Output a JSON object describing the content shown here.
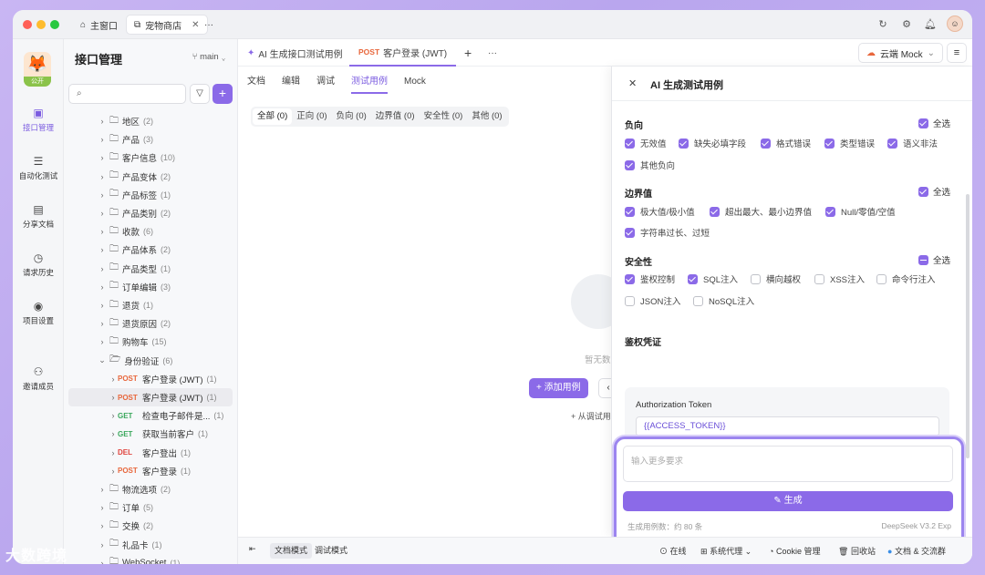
{
  "titlebar": {
    "tabs": [
      {
        "label": "主窗口",
        "icon": "home-icon"
      },
      {
        "label": "宠物商店",
        "icon": "pet-store-icon",
        "close": "✕"
      }
    ],
    "more": "···"
  },
  "rail": {
    "project_badge": "公开",
    "items": [
      {
        "label": "接口管理",
        "icon": "api-icon"
      },
      {
        "label": "自动化测试",
        "icon": "automation-icon"
      },
      {
        "label": "分享文档",
        "icon": "share-docs-icon"
      },
      {
        "label": "请求历史",
        "icon": "history-icon"
      },
      {
        "label": "项目设置",
        "icon": "settings-icon"
      },
      {
        "label": "邀请成员",
        "icon": "invite-icon"
      }
    ]
  },
  "tree": {
    "title": "接口管理",
    "branch": "main",
    "nodes": [
      {
        "type": "folder",
        "label": "地区",
        "count": "(2)"
      },
      {
        "type": "folder",
        "label": "产品",
        "count": "(3)"
      },
      {
        "type": "folder",
        "label": "客户信息",
        "count": "(10)"
      },
      {
        "type": "folder",
        "label": "产品变体",
        "count": "(2)"
      },
      {
        "type": "folder",
        "label": "产品标签",
        "count": "(1)"
      },
      {
        "type": "folder",
        "label": "产品类别",
        "count": "(2)"
      },
      {
        "type": "folder",
        "label": "收款",
        "count": "(6)"
      },
      {
        "type": "folder",
        "label": "产品体系",
        "count": "(2)"
      },
      {
        "type": "folder",
        "label": "产品类型",
        "count": "(1)"
      },
      {
        "type": "folder",
        "label": "订单编辑",
        "count": "(3)"
      },
      {
        "type": "folder",
        "label": "退货",
        "count": "(1)"
      },
      {
        "type": "folder",
        "label": "退货原因",
        "count": "(2)"
      },
      {
        "type": "folder",
        "label": "购物车",
        "count": "(15)"
      },
      {
        "type": "folder-open",
        "label": "身份验证",
        "count": "(6)"
      },
      {
        "type": "api",
        "method": "POST",
        "label": "客户登录 (JWT)",
        "count": "(1)"
      },
      {
        "type": "api",
        "method": "POST",
        "label": "客户登录 (JWT)",
        "count": "(1)",
        "selected": true
      },
      {
        "type": "api",
        "method": "GET",
        "label": "检查电子邮件是...",
        "count": "(1)"
      },
      {
        "type": "api",
        "method": "GET",
        "label": "获取当前客户",
        "count": "(1)"
      },
      {
        "type": "api",
        "method": "DEL",
        "label": "客户登出",
        "count": "(1)"
      },
      {
        "type": "api",
        "method": "POST",
        "label": "客户登录",
        "count": "(1)"
      },
      {
        "type": "folder",
        "label": "物流选项",
        "count": "(2)"
      },
      {
        "type": "folder",
        "label": "订单",
        "count": "(5)"
      },
      {
        "type": "folder",
        "label": "交换",
        "count": "(2)"
      },
      {
        "type": "folder",
        "label": "礼品卡",
        "count": "(1)"
      },
      {
        "type": "folder",
        "label": "WebSocket",
        "count": "(1)"
      }
    ]
  },
  "main": {
    "tabs": [
      {
        "label": "AI 生成接口测试用例",
        "icon": "sparkle-icon"
      },
      {
        "method": "POST",
        "label": "客户登录 (JWT)"
      }
    ],
    "mock_env": "云端 Mock",
    "subtabs": [
      "文档",
      "编辑",
      "调试",
      "测试用例",
      "Mock"
    ],
    "filters": [
      "全部 (0)",
      "正向 (0)",
      "负向 (0)",
      "边界值 (0)",
      "安全性 (0)",
      "其他 (0)"
    ],
    "empty_text": "暂无数",
    "add_case": "+ 添加用例",
    "from_text": "+ 从调试用"
  },
  "drawer": {
    "title": "AI 生成测试用例",
    "select_all": "全选",
    "sections": [
      {
        "title": "负向",
        "options": [
          {
            "label": "无效值",
            "checked": true
          },
          {
            "label": "缺失必填字段",
            "checked": true
          },
          {
            "label": "格式错误",
            "checked": true
          },
          {
            "label": "类型错误",
            "checked": true
          },
          {
            "label": "语义非法",
            "checked": true
          },
          {
            "label": "其他负向",
            "checked": true
          }
        ]
      },
      {
        "title": "边界值",
        "options": [
          {
            "label": "极大值/极小值",
            "checked": true
          },
          {
            "label": "超出最大、最小边界值",
            "checked": true
          },
          {
            "label": "Null/零值/空值",
            "checked": true
          },
          {
            "label": "字符串过长、过短",
            "checked": true
          }
        ]
      },
      {
        "title": "安全性",
        "options": [
          {
            "label": "鉴权控制",
            "checked": true
          },
          {
            "label": "SQL注入",
            "checked": true
          },
          {
            "label": "横向越权",
            "checked": false
          },
          {
            "label": "XSS注入",
            "checked": false
          },
          {
            "label": "命令行注入",
            "checked": false
          },
          {
            "label": "JSON注入",
            "checked": false
          },
          {
            "label": "NoSQL注入",
            "checked": false
          }
        ]
      }
    ],
    "auth_title": "鉴权凭证",
    "auth_label": "Authorization Token",
    "auth_value": "{{ACCESS_TOKEN}}",
    "chat_placeholder": "输入更多要求",
    "generate": "生成",
    "estimate": "生成用例数：约 80 条",
    "model": "DeepSeek V3.2 Exp"
  },
  "statusbar": {
    "modes": [
      "文档模式",
      "调试模式"
    ],
    "items": [
      "在线",
      "系统代理",
      "Cookie 管理",
      "回收站",
      "文档 & 交流群"
    ]
  },
  "watermark": "大数跨境",
  "colors": {
    "accent": "#8b6ae8",
    "post": "#e8673c",
    "get": "#3aa75c",
    "del": "#e0443e"
  }
}
